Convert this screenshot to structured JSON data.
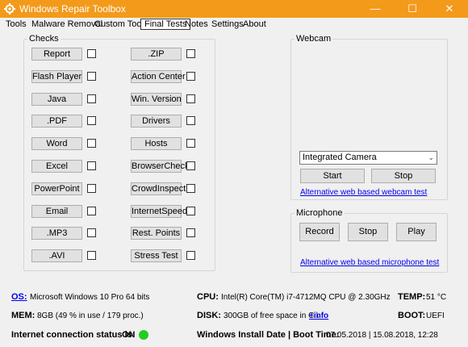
{
  "window": {
    "title": "Windows Repair Toolbox",
    "minimize_glyph": "—",
    "maximize_glyph": "☐",
    "close_glyph": "✕"
  },
  "menu": {
    "tabs": [
      "Tools",
      "Malware Removal",
      "Custom Tools",
      "Final Tests",
      "Notes",
      "Settings",
      "About"
    ],
    "active_tab": "Final Tests"
  },
  "checks": {
    "legend": "Checks",
    "left": [
      {
        "label": "Report",
        "checked": false
      },
      {
        "label": "Flash Player",
        "checked": false
      },
      {
        "label": "Java",
        "checked": false
      },
      {
        "label": ".PDF",
        "checked": false
      },
      {
        "label": "Word",
        "checked": false
      },
      {
        "label": "Excel",
        "checked": false
      },
      {
        "label": "PowerPoint",
        "checked": false
      },
      {
        "label": "Email",
        "checked": false
      },
      {
        "label": ".MP3",
        "checked": false
      },
      {
        "label": ".AVI",
        "checked": false
      }
    ],
    "right": [
      {
        "label": ".ZIP",
        "checked": false
      },
      {
        "label": "Action Center",
        "checked": false
      },
      {
        "label": "Win. Version",
        "checked": false
      },
      {
        "label": "Drivers",
        "checked": false
      },
      {
        "label": "Hosts",
        "checked": false
      },
      {
        "label": "BrowserCheck",
        "checked": false
      },
      {
        "label": "CrowdInspect",
        "checked": false
      },
      {
        "label": "InternetSpeed",
        "checked": false
      },
      {
        "label": "Rest. Points",
        "checked": false
      },
      {
        "label": "Stress Test",
        "checked": false
      }
    ]
  },
  "webcam": {
    "legend": "Webcam",
    "selected_camera": "Integrated Camera",
    "start_label": "Start",
    "stop_label": "Stop",
    "alt_link": "Alternative web based webcam test"
  },
  "microphone": {
    "legend": "Microphone",
    "record_label": "Record",
    "stop_label": "Stop",
    "play_label": "Play",
    "alt_link": "Alternative web based microphone test"
  },
  "sysinfo": {
    "os_label": "OS:",
    "os_value": "Microsoft Windows 10 Pro 64 bits",
    "cpu_label": "CPU:",
    "cpu_value": "Intel(R) Core(TM) i7-4712MQ CPU @ 2.30GHz",
    "temp_label": "TEMP:",
    "temp_value": "51 °C",
    "mem_label": "MEM:",
    "mem_value": "8GB  (49 % in use / 179 proc.)",
    "disk_label": "DISK:",
    "disk_value": "300GB of free space in C:\\",
    "disk_link": "+info",
    "boot_label": "BOOT:",
    "boot_value": "UEFI",
    "internet_label": "Internet connection status is:",
    "internet_value": "ON",
    "internet_color": "#22cc22",
    "install_label": "Windows Install Date | Boot Time:",
    "install_value": "07.05.2018  |  15.08.2018, 12:28"
  },
  "colors": {
    "titlebar": "#f39a1b",
    "link": "#0000ee"
  }
}
